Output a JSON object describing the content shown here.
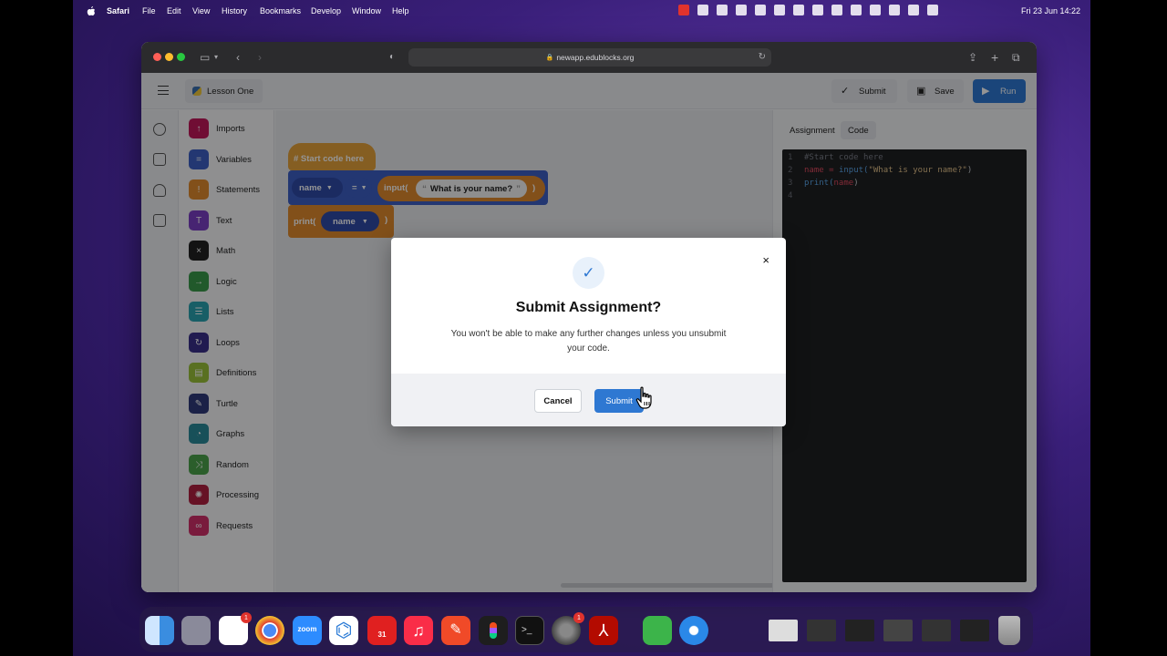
{
  "menubar": {
    "app_name": "Safari",
    "items": [
      "File",
      "Edit",
      "View",
      "History",
      "Bookmarks",
      "Develop",
      "Window",
      "Help"
    ],
    "clock": "Fri 23 Jun  14:22"
  },
  "browser": {
    "url": "newapp.edublocks.org"
  },
  "app": {
    "lesson_title": "Lesson One",
    "submit_label": "Submit",
    "save_label": "Save",
    "run_label": "Run",
    "categories": [
      {
        "label": "Imports",
        "color": "#c2185b"
      },
      {
        "label": "Variables",
        "color": "#3d5fc4"
      },
      {
        "label": "Statements",
        "color": "#e18a2d"
      },
      {
        "label": "Text",
        "color": "#7b3fc4"
      },
      {
        "label": "Math",
        "color": "#222222"
      },
      {
        "label": "Logic",
        "color": "#3a9a4a"
      },
      {
        "label": "Lists",
        "color": "#2aa2b0"
      },
      {
        "label": "Loops",
        "color": "#3a2f8a"
      },
      {
        "label": "Definitions",
        "color": "#9ac23a"
      },
      {
        "label": "Turtle",
        "color": "#2f3a7a"
      },
      {
        "label": "Graphs",
        "color": "#2a8a9a"
      },
      {
        "label": "Random",
        "color": "#4aa24a"
      },
      {
        "label": "Processing",
        "color": "#b02040"
      },
      {
        "label": "Requests",
        "color": "#d0306a"
      }
    ]
  },
  "workspace": {
    "start_block": "# Start code here",
    "var_name": "name",
    "operator": "=",
    "input_fn": "input(",
    "input_string": "What is your name?",
    "close_paren": ")",
    "print_fn": "print(",
    "print_arg": "name"
  },
  "right_panel": {
    "tabs": [
      "Assignment",
      "Code"
    ],
    "active_tab": "Code",
    "code_lines": [
      {
        "num": "1",
        "text": "#Start code here"
      },
      {
        "num": "2",
        "var": "name",
        "eq": " = ",
        "fn": "input(",
        "str": "\"What is your name?\"",
        "end": ")"
      },
      {
        "num": "3",
        "fn": "print(",
        "arg": "name",
        "end": ")"
      },
      {
        "num": "4"
      }
    ]
  },
  "modal": {
    "title": "Submit Assignment?",
    "body": "You won't be able to make any further changes unless you unsubmit your code.",
    "cancel_label": "Cancel",
    "submit_label": "Submit",
    "close_glyph": "×",
    "check_glyph": "✓"
  },
  "dock": {
    "zoom_label": "zoom",
    "calendar_day": "31",
    "slack_badge": "1",
    "settings_badge": "1"
  }
}
